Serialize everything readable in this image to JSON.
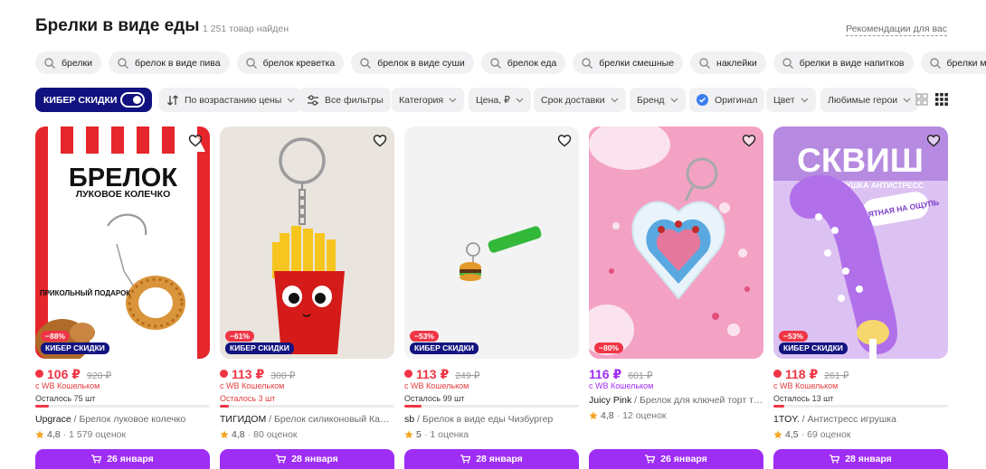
{
  "header": {
    "title": "Брелки в виде еды",
    "found": "1 251 товар найден",
    "recommendations": "Рекомендации для вас"
  },
  "chips": [
    "брелки",
    "брелок в виде пива",
    "брелок креветка",
    "брелок в виде суши",
    "брелок еда",
    "брелки смешные",
    "наклейки",
    "брелки в виде напитков",
    "брелки мемы"
  ],
  "filters": {
    "cyber": "КИБЕР СКИДКИ",
    "sort": "По возрастанию цены",
    "all_filters": "Все фильтры",
    "category": "Категория",
    "price": "Цена, ₽",
    "delivery": "Срок доставки",
    "brand": "Бренд",
    "original": "Оригинал",
    "color": "Цвет",
    "heroes": "Любимые герои"
  },
  "colors": {
    "accent_purple": "#9f2ef5",
    "sale_red": "#ef3545",
    "cyber_navy": "#11117f"
  },
  "products": [
    {
      "image_title": "БРЕЛОК",
      "image_subtitle": "ЛУКОВОЕ КОЛЕЧКО",
      "image_caption": "ПРИКОЛЬНЫЙ ПОДАРОК",
      "discount": "−88%",
      "cyber_badge": "КИБЕР СКИДКИ",
      "price": "106 ₽",
      "old_price": "920 ₽",
      "wallet": "с WB Кошельком",
      "stock": "Осталось 75 шт",
      "stock_fraction": 0.08,
      "brand": "Upgrace",
      "name": " / Брелок луковое колечко",
      "rating": "4,8",
      "reviews": "1 579 оценок",
      "delivery": "26 января"
    },
    {
      "discount": "−61%",
      "cyber_badge": "КИБЕР СКИДКИ",
      "price": "113 ₽",
      "old_price": "300 ₽",
      "wallet": "с WB Кошельком",
      "stock": "Осталось 3 шт",
      "stock_fraction": 0.05,
      "brand": "ТИГИДОМ",
      "name": " / Брелок силиконовый Карто...",
      "rating": "4,8",
      "reviews": "80 оценок",
      "delivery": "28 января"
    },
    {
      "discount": "−53%",
      "cyber_badge": "КИБЕР СКИДКИ",
      "price": "113 ₽",
      "old_price": "249 ₽",
      "wallet": "с WB Кошельком",
      "stock": "Осталось 99 шт",
      "stock_fraction": 0.1,
      "brand": "sb",
      "name": " / Брелок в виде еды Чизбургер",
      "rating": "5",
      "reviews": "1 оценка",
      "delivery": "28 января"
    },
    {
      "discount": "−80%",
      "price": "116 ₽",
      "old_price": "601 ₽",
      "wallet": "с WB Кошельком",
      "brand": "Juicy Pink",
      "name": " / Брелок для ключей торт тор...",
      "rating": "4,8",
      "reviews": "12 оценок",
      "delivery": "26 января"
    },
    {
      "image_title": "СКВИШ",
      "image_subtitle": "МЯГКАЯ ИГРУШКА АНТИСТРЕСС",
      "image_sticker": "ПРИЯТНАЯ НА ОЩУПЬ",
      "discount": "−53%",
      "cyber_badge": "КИБЕР СКИДКИ",
      "price": "118 ₽",
      "old_price": "261 ₽",
      "wallet": "с WB Кошельком",
      "stock": "Осталось 13 шт",
      "stock_fraction": 0.06,
      "brand": "1TOY.",
      "name": " / Антистресс игрушка",
      "rating": "4,5",
      "reviews": "69 оценок",
      "delivery": "28 января"
    }
  ]
}
